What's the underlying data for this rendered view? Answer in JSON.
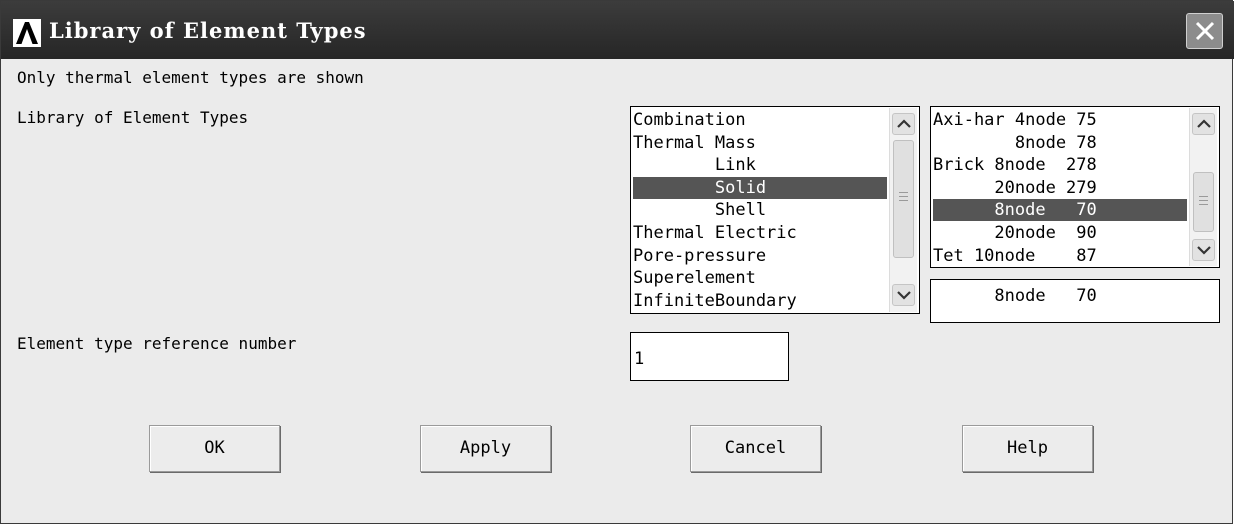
{
  "window": {
    "title": "Library of Element Types"
  },
  "labels": {
    "info": "Only thermal element types are shown",
    "library": "Library of Element Types",
    "ref_number": "Element type reference number"
  },
  "category_list": {
    "items": [
      "Combination",
      "Thermal Mass",
      "        Link",
      "        Solid",
      "        Shell",
      "Thermal Electric",
      "Pore-pressure",
      "Superelement",
      "InfiniteBoundary"
    ],
    "selected_index": 3
  },
  "element_list": {
    "items": [
      "Axi-har 4node 75",
      "        8node 78",
      "Brick 8node  278",
      "      20node 279",
      "      8node   70",
      "      20node  90",
      "Tet 10node    87"
    ],
    "selected_index": 4
  },
  "selection_display": "      8node   70",
  "ref_input": {
    "value": "1"
  },
  "buttons": {
    "ok": "OK",
    "apply": "Apply",
    "cancel": "Cancel",
    "help": "Help"
  },
  "icons": {
    "app_logo": "ansys-logo-icon",
    "close": "close-icon",
    "scroll_up": "chevron-up-icon",
    "scroll_down": "chevron-down-icon"
  },
  "colors": {
    "titlebar": "#2e2e2e",
    "dialog_bg": "#ebebeb",
    "selection": "#555555"
  }
}
